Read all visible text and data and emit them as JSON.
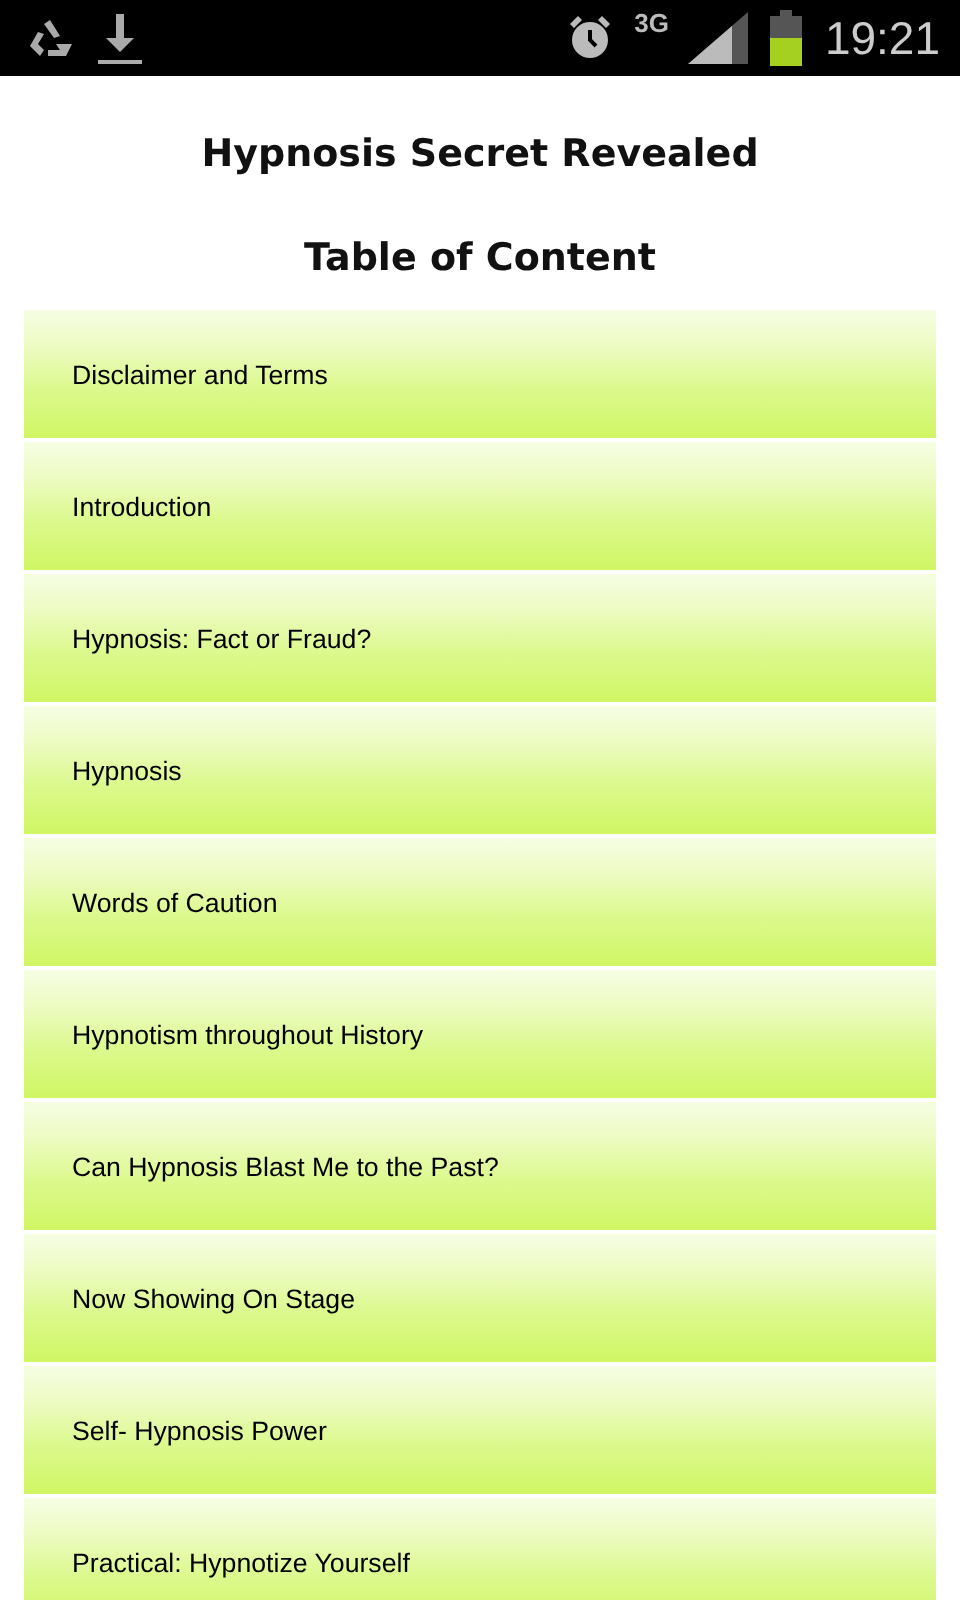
{
  "status_bar": {
    "network": "3G",
    "time": "19:21"
  },
  "title": "Hypnosis Secret Revealed",
  "subtitle": "Table of Content",
  "chapters": [
    {
      "label": "Disclaimer and Terms"
    },
    {
      "label": "Introduction"
    },
    {
      "label": "Hypnosis: Fact or Fraud?"
    },
    {
      "label": "Hypnosis"
    },
    {
      "label": "Words of Caution"
    },
    {
      "label": "Hypnotism throughout History"
    },
    {
      "label": "Can Hypnosis Blast Me to the Past?"
    },
    {
      "label": "Now Showing On Stage"
    },
    {
      "label": "Self- Hypnosis Power"
    },
    {
      "label": "Practical: Hypnotize Yourself"
    }
  ]
}
